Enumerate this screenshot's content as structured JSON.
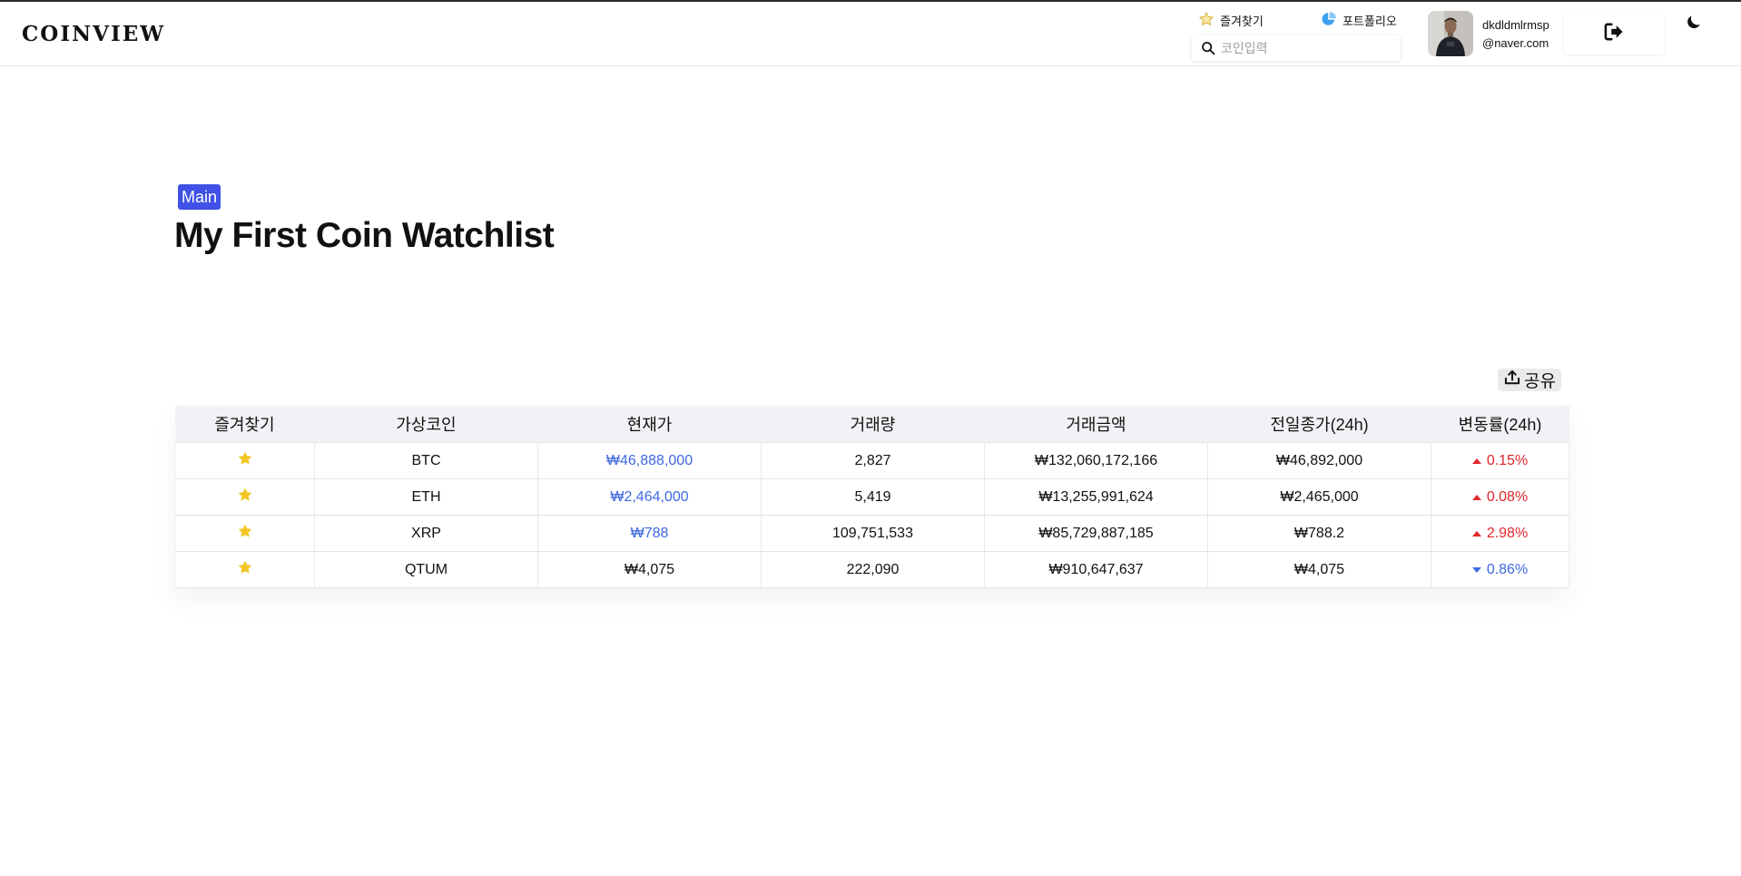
{
  "header": {
    "logo": "COINVIEW",
    "nav": {
      "favorites_label": "즐겨찾기",
      "portfolio_label": "포트폴리오"
    },
    "search": {
      "placeholder": "코인입력",
      "value": ""
    },
    "user": {
      "name": "dkdldmlrmsp",
      "email": "@naver.com"
    }
  },
  "page": {
    "badge": "Main",
    "title": "My First Coin Watchlist",
    "share_label": "공유"
  },
  "table": {
    "columns": [
      "즐겨찾기",
      "가상코인",
      "현재가",
      "거래량",
      "거래금액",
      "전일종가(24h)",
      "변동률(24h)"
    ],
    "rows": [
      {
        "favorite": true,
        "coin": "BTC",
        "price": "₩46,888,000",
        "price_color": "blue",
        "volume": "2,827",
        "amount": "₩132,060,172,166",
        "prev_close": "₩46,892,000",
        "change": "0.15%",
        "direction": "up"
      },
      {
        "favorite": true,
        "coin": "ETH",
        "price": "₩2,464,000",
        "price_color": "blue",
        "volume": "5,419",
        "amount": "₩13,255,991,624",
        "prev_close": "₩2,465,000",
        "change": "0.08%",
        "direction": "up"
      },
      {
        "favorite": true,
        "coin": "XRP",
        "price": "₩788",
        "price_color": "blue",
        "volume": "109,751,533",
        "amount": "₩85,729,887,185",
        "prev_close": "₩788.2",
        "change": "2.98%",
        "direction": "up"
      },
      {
        "favorite": true,
        "coin": "QTUM",
        "price": "₩4,075",
        "price_color": "black",
        "volume": "222,090",
        "amount": "₩910,647,637",
        "prev_close": "₩4,075",
        "change": "0.86%",
        "direction": "down"
      }
    ]
  },
  "colors": {
    "accent": "#3f51e6",
    "price_blue": "#3f68e0",
    "up_red": "#e0262c",
    "star_yellow": "#f3c623",
    "header_bg": "#f1f2f5"
  },
  "icons": {
    "favorites": "star-outline-icon",
    "portfolio": "pie-chart-icon",
    "search": "search-icon",
    "logout": "logout-icon",
    "theme": "moon-icon",
    "share": "upload-share-icon",
    "row_favorite": "star-filled-icon"
  }
}
